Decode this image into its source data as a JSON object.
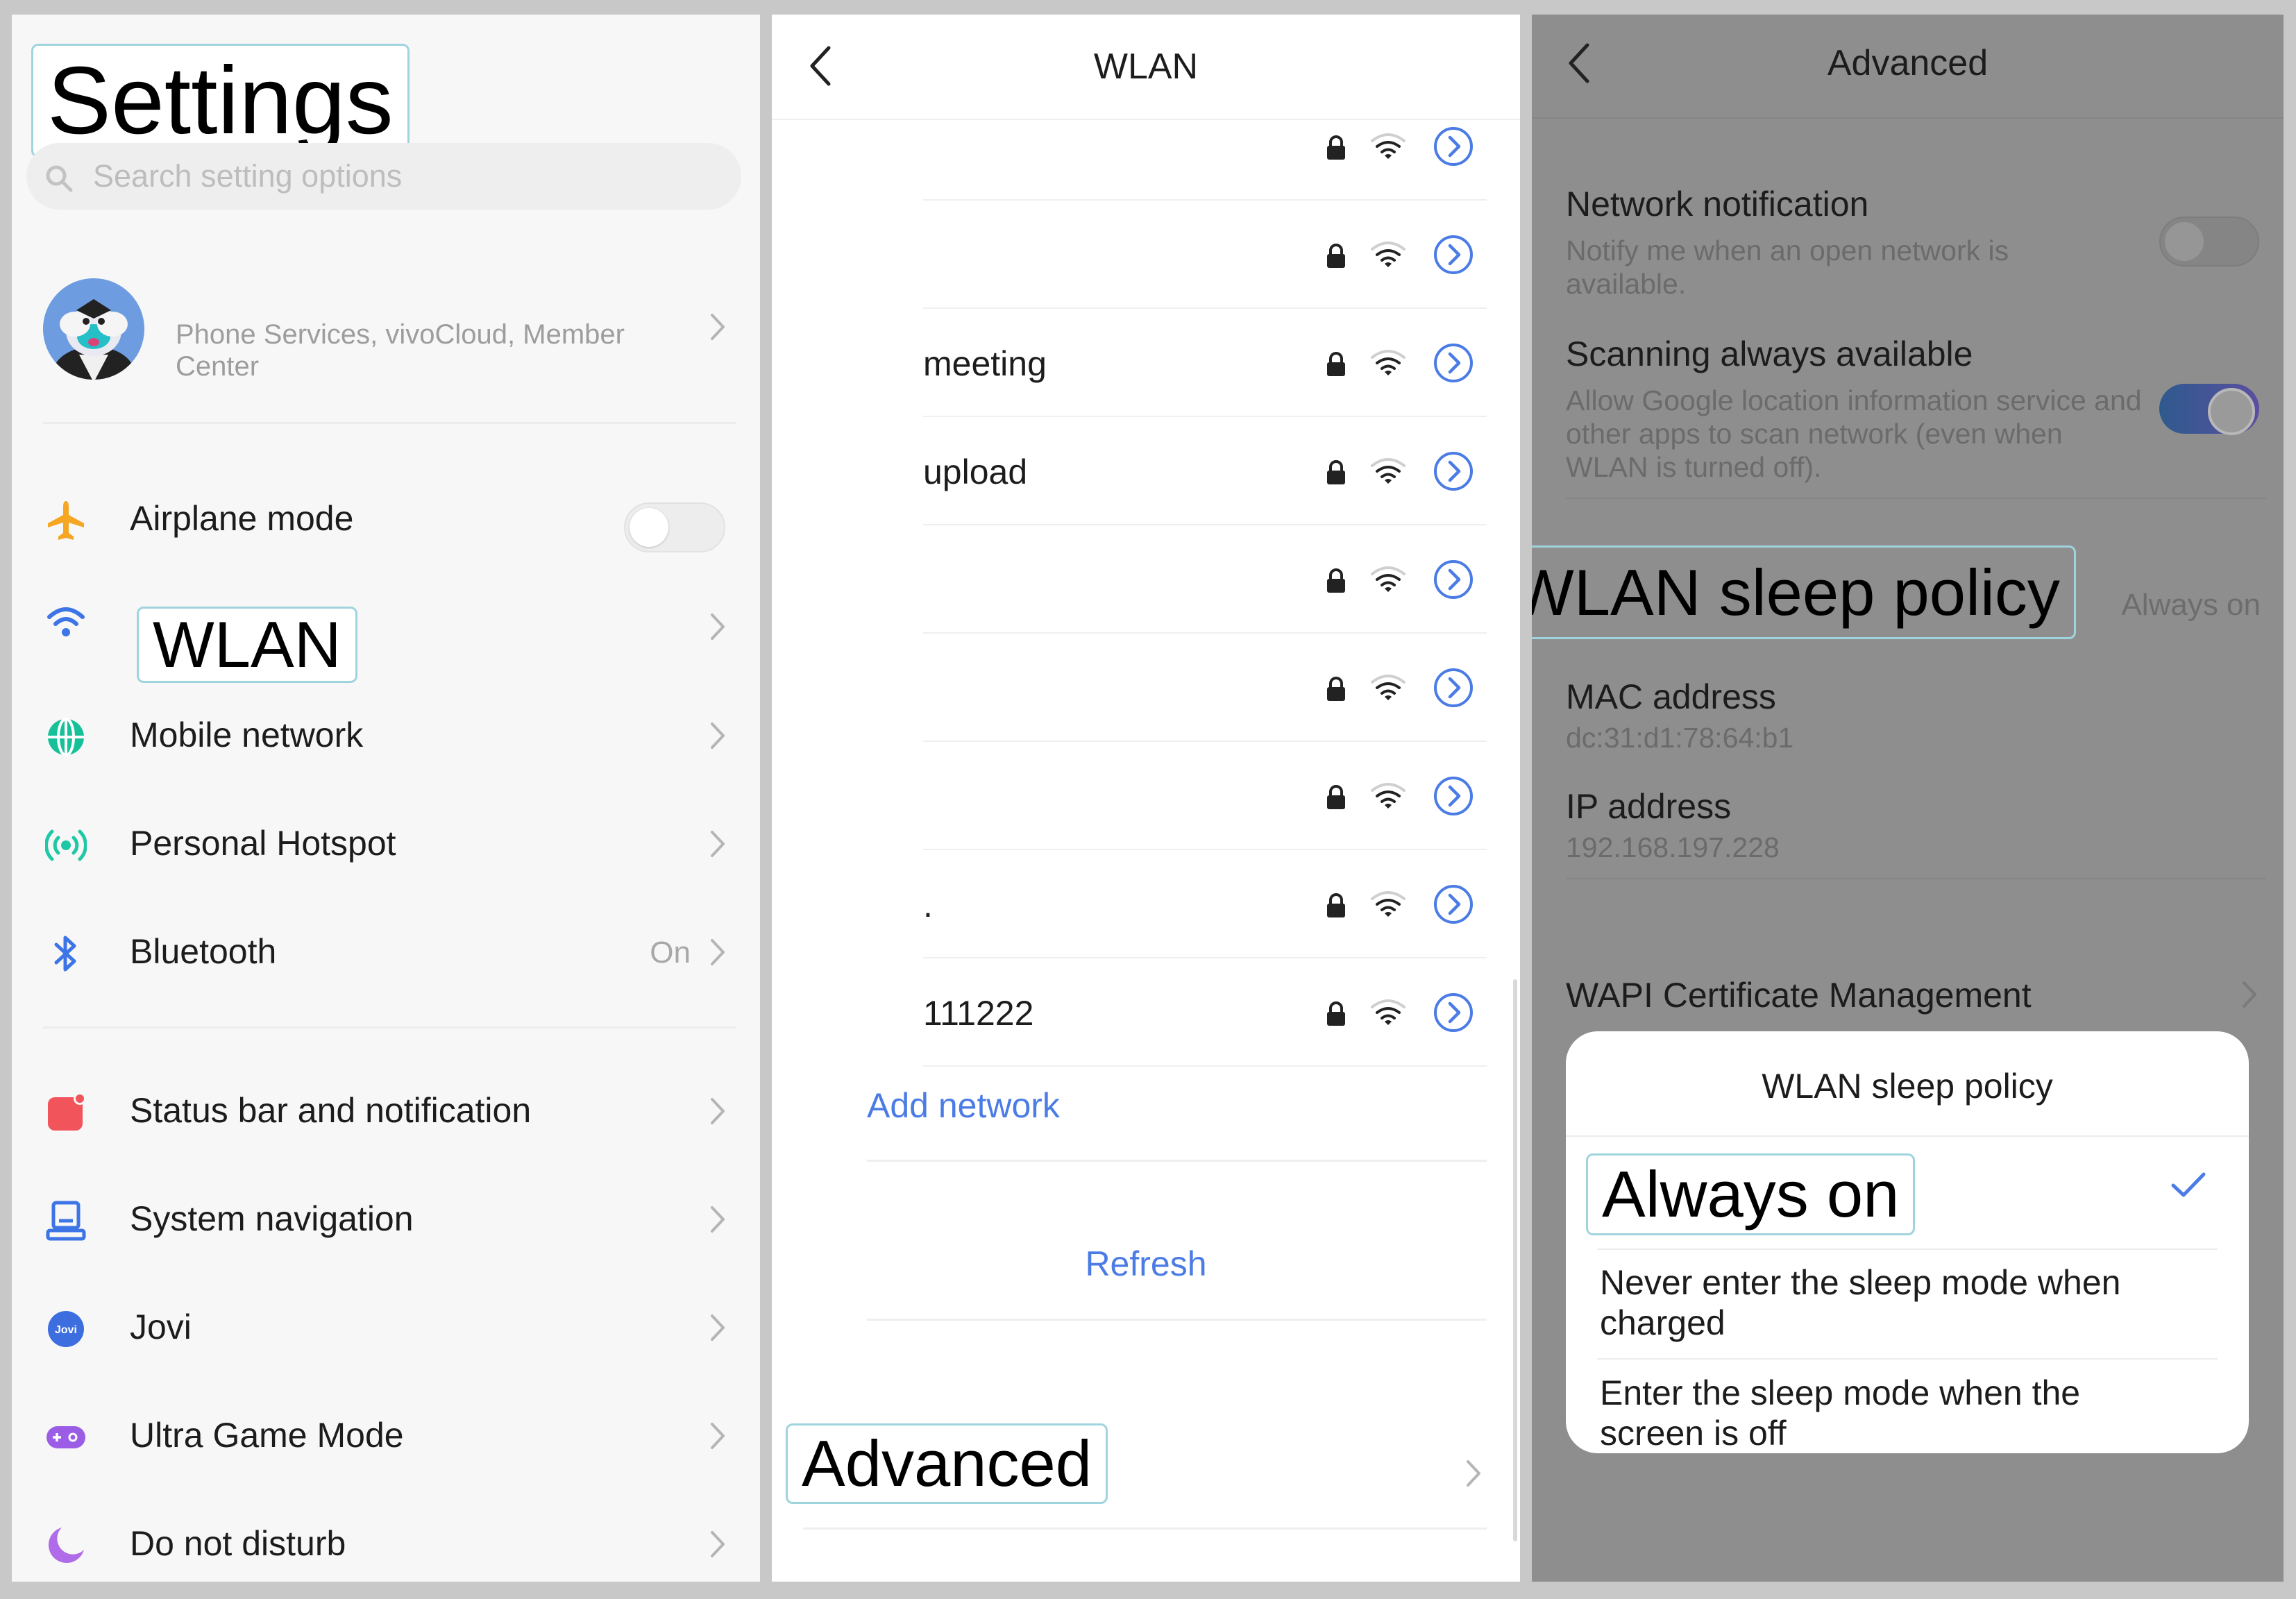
{
  "settings": {
    "title": "Settings",
    "search_placeholder": "Search setting options",
    "profile_desc": "Phone Services, vivoCloud, Member Center",
    "items": [
      {
        "label": "Airplane mode",
        "icon": "airplane-icon",
        "control": "toggle",
        "state": "off"
      },
      {
        "label": "WLAN",
        "icon": "wifi-icon"
      },
      {
        "label": "Mobile network",
        "icon": "globe-icon"
      },
      {
        "label": "Personal Hotspot",
        "icon": "hotspot-icon"
      },
      {
        "label": "Bluetooth",
        "icon": "bluetooth-icon",
        "value": "On"
      },
      {
        "label": "Status bar and notification",
        "icon": "notification-icon"
      },
      {
        "label": "System navigation",
        "icon": "navigation-icon"
      },
      {
        "label": "Jovi",
        "icon": "jovi-icon",
        "icon_text": "Jovi"
      },
      {
        "label": "Ultra Game Mode",
        "icon": "gamepad-icon"
      },
      {
        "label": "Do not disturb",
        "icon": "moon-icon"
      }
    ]
  },
  "wlan": {
    "title": "WLAN",
    "networks": [
      {
        "ssid": ""
      },
      {
        "ssid": ""
      },
      {
        "ssid": "meeting"
      },
      {
        "ssid": "upload"
      },
      {
        "ssid": ""
      },
      {
        "ssid": ""
      },
      {
        "ssid": ""
      },
      {
        "ssid": "."
      },
      {
        "ssid": "111222"
      }
    ],
    "add_network": "Add network",
    "refresh": "Refresh",
    "advanced": "Advanced"
  },
  "advanced": {
    "title": "Advanced",
    "network_notification": {
      "title": "Network notification",
      "subtitle": "Notify me when an open network is available.",
      "state": "off"
    },
    "scanning": {
      "title": "Scanning always available",
      "subtitle": "Allow Google location information service and other apps to scan network (even when WLAN is turned off).",
      "state": "on"
    },
    "sleep_policy": {
      "title": "WLAN sleep policy",
      "value": "Always on"
    },
    "mac": {
      "title": "MAC address",
      "value": "dc:31:d1:78:64:b1"
    },
    "ip": {
      "title": "IP address",
      "value": "192.168.197.228"
    },
    "wapi": {
      "title": "WAPI Certificate Management"
    },
    "dialog": {
      "title": "WLAN sleep policy",
      "options": [
        {
          "label": "Always on",
          "selected": true
        },
        {
          "label": "Never enter the sleep mode when charged",
          "selected": false
        },
        {
          "label": "Enter the sleep mode when the screen is off",
          "selected": false
        }
      ]
    }
  },
  "colors": {
    "accent_blue": "#4b7be5",
    "airplane_orange": "#f5a623",
    "hotspot_teal": "#1ec8a5",
    "notification_red": "#f2545b",
    "game_purple": "#9b5de5",
    "moon_purple": "#b06ce8",
    "dim_overlay": "#8e8e8e"
  }
}
